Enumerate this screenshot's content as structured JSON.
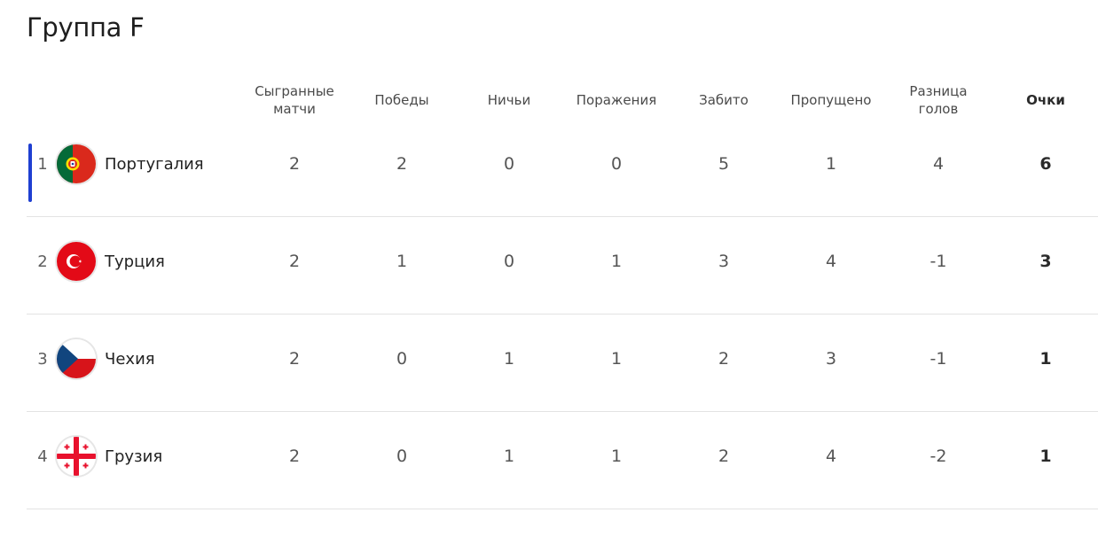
{
  "title": "Группа F",
  "columns": {
    "played": "Сыгранные\nматчи",
    "wins": "Победы",
    "draws": "Ничьи",
    "losses": "Поражения",
    "scored": "Забито",
    "conceded": "Пропущено",
    "diff": "Разница\nголов",
    "points": "Очки"
  },
  "rows": [
    {
      "pos": "1",
      "team": "Португалия",
      "flag": "portugal-flag-icon",
      "played": "2",
      "wins": "2",
      "draws": "0",
      "losses": "0",
      "scored": "5",
      "conceded": "1",
      "diff": "4",
      "points": "6",
      "highlight_color": "#1f3fd1"
    },
    {
      "pos": "2",
      "team": "Турция",
      "flag": "turkey-flag-icon",
      "played": "2",
      "wins": "1",
      "draws": "0",
      "losses": "1",
      "scored": "3",
      "conceded": "4",
      "diff": "-1",
      "points": "3"
    },
    {
      "pos": "3",
      "team": "Чехия",
      "flag": "czechia-flag-icon",
      "played": "2",
      "wins": "0",
      "draws": "1",
      "losses": "1",
      "scored": "2",
      "conceded": "3",
      "diff": "-1",
      "points": "1"
    },
    {
      "pos": "4",
      "team": "Грузия",
      "flag": "georgia-flag-icon",
      "played": "2",
      "wins": "0",
      "draws": "1",
      "losses": "1",
      "scored": "2",
      "conceded": "4",
      "diff": "-2",
      "points": "1"
    }
  ]
}
